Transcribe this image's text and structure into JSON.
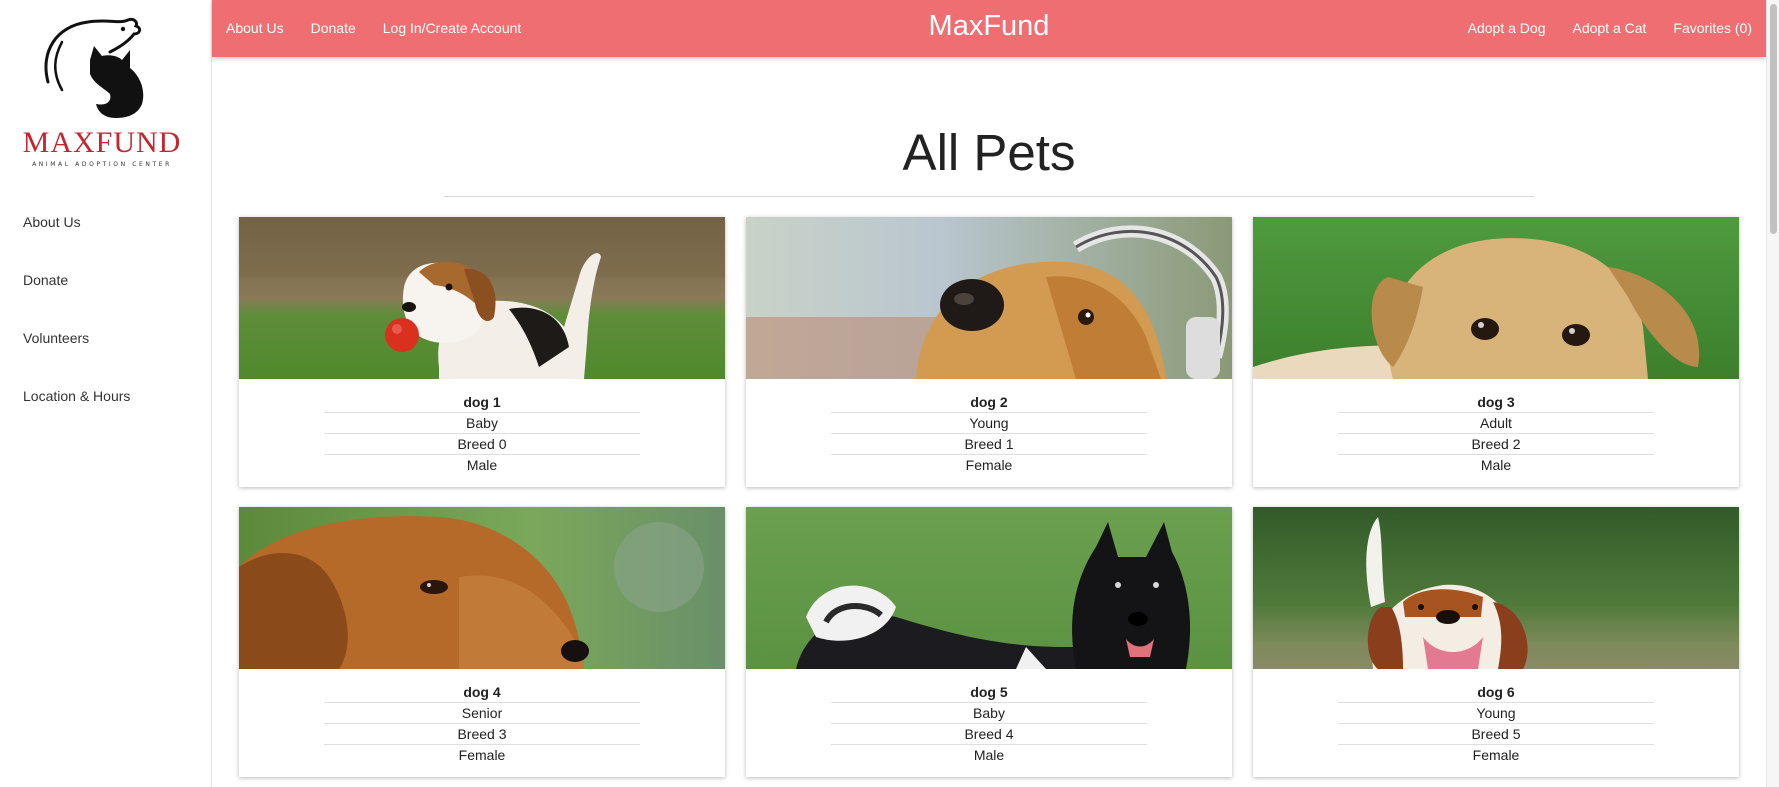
{
  "sidebar": {
    "logo_text": "MAXFUND",
    "logo_subtext": "ANIMAL ADOPTION CENTER",
    "items": [
      {
        "label": "About Us"
      },
      {
        "label": "Donate"
      },
      {
        "label": "Volunteers"
      },
      {
        "label": "Location & Hours"
      }
    ]
  },
  "topbar": {
    "brand": "MaxFund",
    "left_links": [
      {
        "label": "About Us"
      },
      {
        "label": "Donate"
      },
      {
        "label": "Log In/Create Account"
      }
    ],
    "right_links": [
      {
        "label": "Adopt a Dog"
      },
      {
        "label": "Adopt a Cat"
      },
      {
        "label": "Favorites (0)"
      }
    ],
    "color": "#ef6e72"
  },
  "main": {
    "title": "All Pets",
    "pets": [
      {
        "name": "dog 1",
        "age": "Baby",
        "breed": "Breed 0",
        "sex": "Male",
        "photo": "beagle-puppy-with-ball"
      },
      {
        "name": "dog 2",
        "age": "Young",
        "breed": "Breed 1",
        "sex": "Female",
        "photo": "golden-dog-with-headphones"
      },
      {
        "name": "dog 3",
        "age": "Adult",
        "breed": "Breed 2",
        "sex": "Male",
        "photo": "labrador-puppy"
      },
      {
        "name": "dog 4",
        "age": "Senior",
        "breed": "Breed 3",
        "sex": "Female",
        "photo": "dachshund-profile"
      },
      {
        "name": "dog 5",
        "age": "Baby",
        "breed": "Breed 4",
        "sex": "Male",
        "photo": "black-akita-on-grass"
      },
      {
        "name": "dog 6",
        "age": "Young",
        "breed": "Breed 5",
        "sex": "Female",
        "photo": "basset-hound-running"
      }
    ]
  }
}
